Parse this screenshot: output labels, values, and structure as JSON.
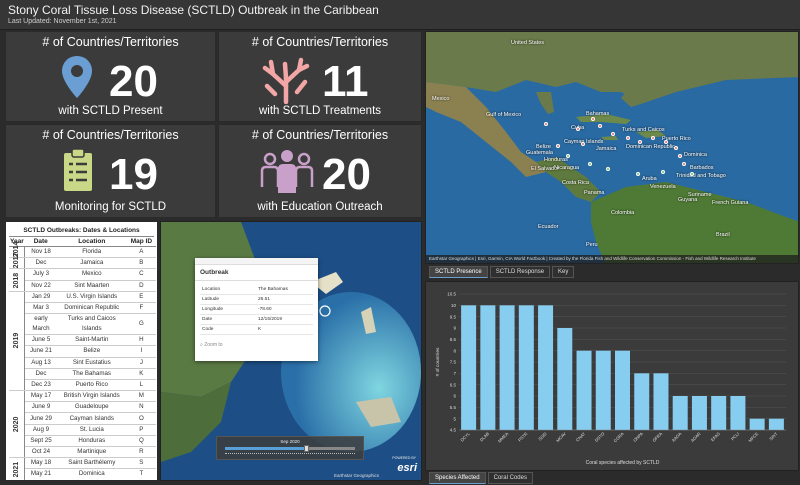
{
  "header": {
    "title": "Stony Coral Tissue Loss Disease (SCTLD) Outbreak in the Caribbean",
    "updated": "Last Updated: November 1st, 2021"
  },
  "tiles": [
    {
      "head": "# of Countries/Territories",
      "value": "20",
      "foot": "with SCTLD Present",
      "icon": "map-pin-icon"
    },
    {
      "head": "# of Countries/Territories",
      "value": "11",
      "foot": "with SCTLD Treatments",
      "icon": "coral-icon"
    },
    {
      "head": "# of Countries/Territories",
      "value": "19",
      "foot": "Monitoring for SCTLD",
      "icon": "clipboard-icon"
    },
    {
      "head": "# of Countries/Territories",
      "value": "20",
      "foot": "with Education Outreach",
      "icon": "people-group-icon"
    }
  ],
  "colors": {
    "pin": "#6b9fd4",
    "coral": "#f2a6a6",
    "clipboard": "#c8d887",
    "people": "#c9a0c9",
    "bar": "#87cdf0"
  },
  "map": {
    "labels": [
      "United States",
      "Mexico",
      "Gulf of Mexico",
      "Cuba",
      "Bahamas",
      "Turks and Caicos",
      "Cayman Islands",
      "Dominican Republic",
      "Puerto Rico",
      "Jamaica",
      "Belize",
      "Honduras",
      "Guatemala",
      "El Salvador",
      "Nicaragua",
      "Costa Rica",
      "Panama",
      "Colombia",
      "Venezuela",
      "Guyana",
      "Suriname",
      "French Guiana",
      "Ecuador",
      "Peru",
      "Brazil",
      "Trinidad and Tobago",
      "Barbados",
      "Dominica",
      "Aruba"
    ],
    "credit": "Earthstar Geographics | Esri, Garmin, CIA World Factbook | Created by the Florida Fish and Wildlife Conservation Commission - Fish and Wildlife Research Institute",
    "powered": "Powered by Esri",
    "tabs": [
      "SCTLD Presence",
      "SCTLD Response",
      "Key"
    ]
  },
  "outbreaks": {
    "title": "SCTLD Outbreaks: Dates & Locations",
    "columns": [
      "Year",
      "Date",
      "Location",
      "Map ID"
    ],
    "groups": [
      {
        "year": "2014",
        "rows": [
          [
            "Nov 18",
            "Florida",
            "A"
          ]
        ]
      },
      {
        "year": "2017",
        "rows": [
          [
            "Dec",
            "Jamaica",
            "B"
          ]
        ]
      },
      {
        "year": "2018",
        "rows": [
          [
            "July 3",
            "Mexico",
            "C"
          ],
          [
            "Nov 22",
            "Sint Maarten",
            "D"
          ]
        ]
      },
      {
        "year": "2019",
        "rows": [
          [
            "Jan 29",
            "U.S. Virgin Islands",
            "E"
          ],
          [
            "Mar 3",
            "Dominican Republic",
            "F"
          ],
          [
            "early March",
            "Turks and Caicos Islands",
            "G"
          ],
          [
            "June 5",
            "Saint-Martin",
            "H"
          ],
          [
            "June 21",
            "Belize",
            "I"
          ],
          [
            "Aug 13",
            "Sint Eustatius",
            "J"
          ],
          [
            "Dec",
            "The Bahamas",
            "K"
          ],
          [
            "Dec 23",
            "Puerto Rico",
            "L"
          ]
        ]
      },
      {
        "year": "2020",
        "rows": [
          [
            "May 17",
            "British Virgin Islands",
            "M"
          ],
          [
            "June 9",
            "Guadeloupe",
            "N"
          ],
          [
            "June 29",
            "Cayman Islands",
            "O"
          ],
          [
            "Aug 9",
            "St. Lucia",
            "P"
          ],
          [
            "Sept 25",
            "Honduras",
            "Q"
          ],
          [
            "Oct 24",
            "Martinique",
            "R"
          ]
        ]
      },
      {
        "year": "2021",
        "rows": [
          [
            "May 18",
            "Saint Barthélemy",
            "S"
          ],
          [
            "May 21",
            "Dominica",
            "T"
          ]
        ]
      }
    ]
  },
  "popup": {
    "title": "Outbreak",
    "fields": [
      [
        "Location",
        "The Bahamas"
      ],
      [
        "Latitude",
        "26.51"
      ],
      [
        "Longitude",
        "-78.60"
      ],
      [
        "Date",
        "12/15/2019"
      ],
      [
        "Code",
        "K"
      ]
    ],
    "zoom": "Zoom to"
  },
  "slider": {
    "label": "Sep 2020",
    "position": 0.62
  },
  "sat": {
    "credit": "Earthstar Geographics",
    "powered": "POWERED BY",
    "logo": "esri"
  },
  "chart_tabs": [
    "Species Affected",
    "Coral Codes"
  ],
  "chart_data": {
    "type": "bar",
    "categories": [
      "DCYL",
      "DLAB",
      "MMEA",
      "PSTR",
      "SSID",
      "MCAV",
      "CNAT",
      "DSTO",
      "CGRA",
      "ONPA",
      "OFRA",
      "AAGA",
      "AGAR",
      "EFAS",
      "PCLI",
      "MFCE",
      "SINT"
    ],
    "values": [
      10,
      10,
      10,
      10,
      10,
      9,
      8,
      8,
      8,
      7,
      7,
      6,
      6,
      6,
      6,
      5,
      5
    ],
    "ylim": [
      4.5,
      10.5
    ],
    "yticks": [
      "4.5",
      "5",
      "5.5",
      "6",
      "6.5",
      "7",
      "7.5",
      "8",
      "8.5",
      "9",
      "9.5",
      "10",
      "10.5"
    ],
    "xlabel": "Coral species affected by SCTLD",
    "ylabel": "# of countries",
    "grid": true
  }
}
